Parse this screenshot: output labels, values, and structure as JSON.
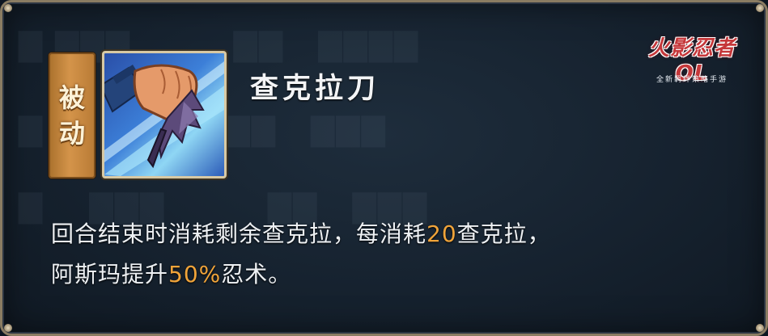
{
  "skill": {
    "type_label_chars": [
      "被",
      "动"
    ],
    "name": "查克拉刀",
    "icon": "chakra-blade-fist-icon",
    "description": {
      "line1_before": "回合结束时消耗剩余查克拉，每消耗",
      "line1_value": "20",
      "line1_after": "查克拉，",
      "line2_before": "阿斯玛提升",
      "line2_value": "50%",
      "line2_after": "忍术。"
    }
  },
  "logo": {
    "title": "火影忍者OL",
    "subtitle": "全新羁绊策略手游"
  },
  "colors": {
    "highlight": "#f0a43a",
    "text": "#eef1f4",
    "frame": "#8a7c62",
    "passive_tag": "#d4944a"
  }
}
